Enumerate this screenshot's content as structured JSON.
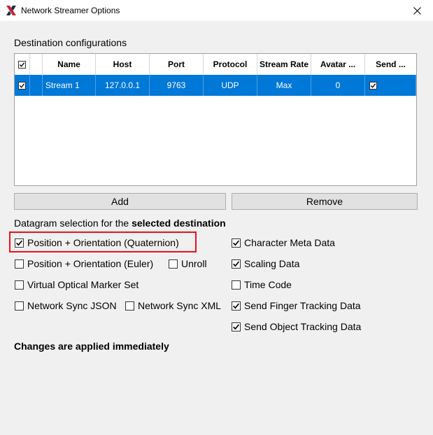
{
  "window": {
    "title": "Network Streamer Options",
    "logo_color": "#c0283a"
  },
  "destinations": {
    "section_label": "Destination configurations",
    "columns": [
      "Name",
      "Host",
      "Port",
      "Protocol",
      "Stream Rate",
      "Avatar ...",
      "Send ..."
    ],
    "header_checkbox": true,
    "rows": [
      {
        "checked": true,
        "name": "Stream 1",
        "host": "127.0.0.1",
        "port": "9763",
        "protocol": "UDP",
        "stream_rate": "Max",
        "avatar": "0",
        "send": true
      }
    ],
    "selection_color": "#0078d7"
  },
  "buttons": {
    "add": "Add",
    "remove": "Remove"
  },
  "datagram": {
    "label_prefix": "Datagram selection for the ",
    "label_bold": "selected destination",
    "options": {
      "pos_quat": {
        "label": "Position + Orientation (Quaternion)",
        "checked": true
      },
      "pos_euler": {
        "label": "Position + Orientation (Euler)",
        "checked": false
      },
      "unroll": {
        "label": "Unroll",
        "checked": false
      },
      "optical": {
        "label": "Virtual Optical Marker Set",
        "checked": false
      },
      "sync_json": {
        "label": "Network Sync JSON",
        "checked": false
      },
      "sync_xml": {
        "label": "Network Sync XML",
        "checked": false
      },
      "char_meta": {
        "label": "Character Meta Data",
        "checked": true
      },
      "scaling": {
        "label": "Scaling Data",
        "checked": true
      },
      "timecode": {
        "label": "Time Code",
        "checked": false
      },
      "finger": {
        "label": "Send Finger Tracking Data",
        "checked": true
      },
      "object": {
        "label": "Send Object Tracking Data",
        "checked": true
      }
    },
    "highlight_color": "#e5121b"
  },
  "footer": {
    "note": "Changes are applied immediately"
  }
}
